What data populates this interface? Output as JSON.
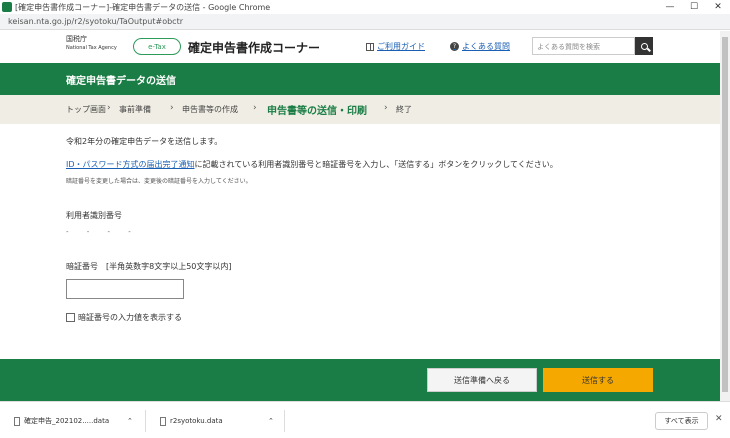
{
  "browser": {
    "window_title": "[確定申告書作成コーナー]-確定申告書データの送信 - Google Chrome",
    "url": "keisan.nta.go.jp/r2/syotoku/TaOutput#obctr",
    "minimize": "—",
    "maximize": "☐",
    "close": "✕"
  },
  "header": {
    "agency_line1": "国税庁",
    "agency_line2": "National Tax Agency",
    "logo_text": "e-Tax",
    "site_title": "確定申告書作成コーナー",
    "guide_link": "ご利用ガイド",
    "faq_link": "よくある質問",
    "search_placeholder": "よくある質問を検索"
  },
  "page": {
    "heading": "確定申告書データの送信"
  },
  "steps": {
    "items": [
      "トップ画面",
      "事前準備",
      "申告書等の作成",
      "申告書等の送信・印刷",
      "終了"
    ],
    "separator": "›"
  },
  "content": {
    "intro": "令和2年分の確定申告データを送信します。",
    "instruction_link": "ID・パスワード方式の届出完了通知",
    "instruction_rest": "に記載されている利用者識別番号と暗証番号を入力し、「送信する」ボタンをクリックしてください。",
    "note": "暗証番号を変更した場合は、変更後の暗証番号を入力してください。",
    "id_label": "利用者識別番号",
    "id_value": "- - - -",
    "pw_label": "暗証番号　[半角英数字8文字以上50文字以内]",
    "show_pw_label": "暗証番号の入力値を表示する"
  },
  "actions": {
    "back_label": "送信準備へ戻る",
    "send_label": "送信する"
  },
  "downloads": {
    "items": [
      {
        "name": "確定申告_202102.....data"
      },
      {
        "name": "r2syotoku.data"
      }
    ],
    "show_all": "すべて表示",
    "close": "✕"
  },
  "colors": {
    "primary_green": "#1a7d45",
    "send_button": "#f5a800",
    "step_bar": "#f0eee4"
  }
}
